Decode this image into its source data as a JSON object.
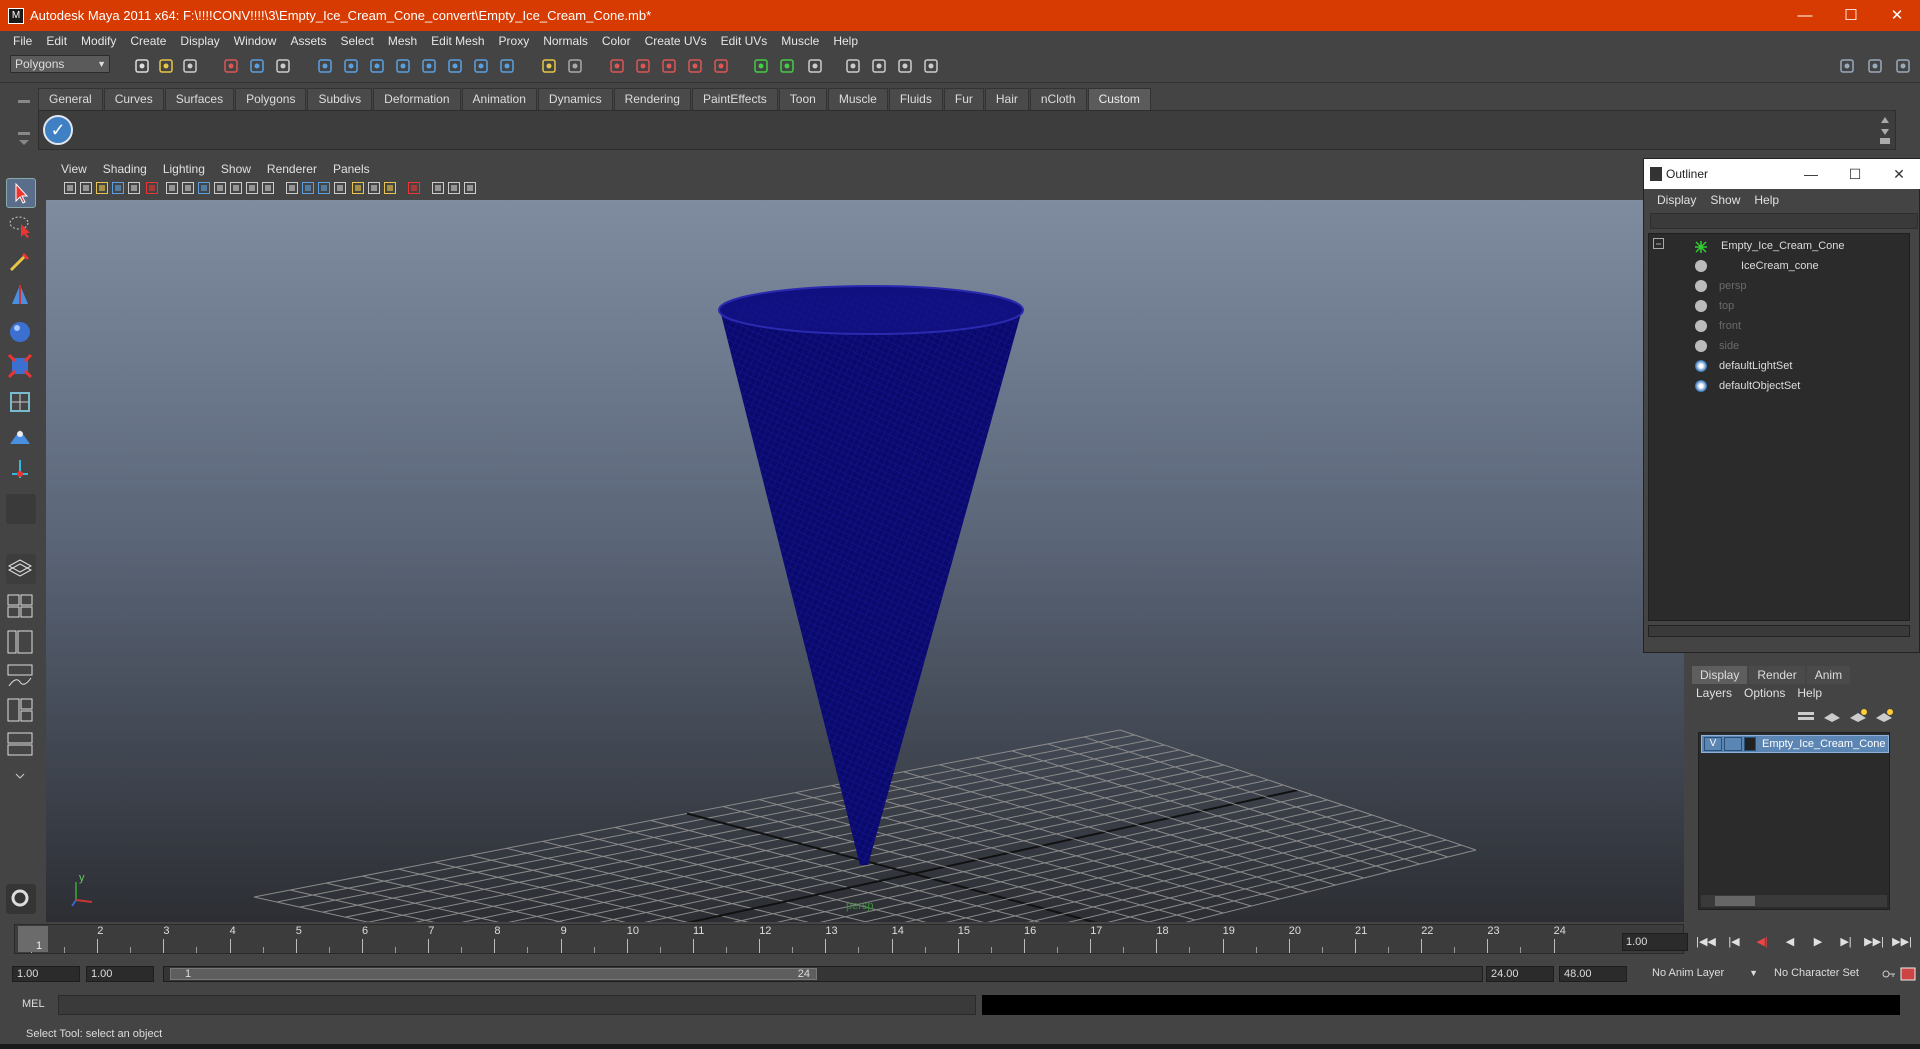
{
  "window": {
    "title": "Autodesk Maya 2011 x64: F:\\!!!!CONV!!!!\\3\\Empty_Ice_Cream_Cone_convert\\Empty_Ice_Cream_Cone.mb*",
    "minimize": "—",
    "maximize": "☐",
    "close": "✕"
  },
  "menubar": [
    "File",
    "Edit",
    "Modify",
    "Create",
    "Display",
    "Window",
    "Assets",
    "Select",
    "Mesh",
    "Edit Mesh",
    "Proxy",
    "Normals",
    "Color",
    "Create UVs",
    "Edit UVs",
    "Muscle",
    "Help"
  ],
  "status_line": {
    "mode": "Polygons"
  },
  "shelf": {
    "tabs": [
      "General",
      "Curves",
      "Surfaces",
      "Polygons",
      "Subdivs",
      "Deformation",
      "Animation",
      "Dynamics",
      "Rendering",
      "PaintEffects",
      "Toon",
      "Muscle",
      "Fluids",
      "Fur",
      "Hair",
      "nCloth",
      "Custom"
    ],
    "active_tab": "Custom",
    "item_icon": "checkmark-icon"
  },
  "viewport": {
    "menu": [
      "View",
      "Shading",
      "Lighting",
      "Show",
      "Renderer",
      "Panels"
    ],
    "camera_label": "persp",
    "mesh_color": "#0a0a6e",
    "axis_y": "y",
    "axis_x": "x"
  },
  "outliner": {
    "title": "Outliner",
    "menu": [
      "Display",
      "Show",
      "Help"
    ],
    "items": [
      {
        "label": "Empty_Ice_Cream_Cone",
        "dim": false
      },
      {
        "label": "IceCream_cone",
        "dim": false
      },
      {
        "label": "persp",
        "dim": true
      },
      {
        "label": "top",
        "dim": true
      },
      {
        "label": "front",
        "dim": true
      },
      {
        "label": "side",
        "dim": true
      },
      {
        "label": "defaultLightSet",
        "dim": false
      },
      {
        "label": "defaultObjectSet",
        "dim": false
      }
    ]
  },
  "layer_editor": {
    "tabs": [
      "Display",
      "Render",
      "Anim"
    ],
    "active_tab": "Display",
    "menu": [
      "Layers",
      "Options",
      "Help"
    ],
    "layer": {
      "visible": "V",
      "name": "Empty_Ice_Cream_Cone"
    }
  },
  "time_slider": {
    "ticks": [
      "1",
      "2",
      "3",
      "4",
      "5",
      "6",
      "7",
      "8",
      "9",
      "10",
      "11",
      "12",
      "13",
      "14",
      "15",
      "16",
      "17",
      "18",
      "19",
      "20",
      "21",
      "22",
      "23",
      "24"
    ],
    "current_frame": "1",
    "current_time_field": "1.00",
    "playback": [
      "|◀◀",
      "|◀",
      "◀|",
      "◀",
      "▶",
      "▶|",
      "▶▶|",
      "▶▶|"
    ]
  },
  "range_slider": {
    "start_time": "1.00",
    "playback_start": "1.00",
    "range_start": "1",
    "range_end": "24",
    "playback_end": "24.00",
    "end_time": "48.00",
    "anim_layer": "No Anim Layer",
    "character_set": "No Character Set"
  },
  "command_line": {
    "label": "MEL"
  },
  "help_line": {
    "text": "Select Tool: select an object"
  },
  "colors": {
    "title_bar": "#d83b01",
    "ui_bg": "#444444",
    "selection": "#5b85b3"
  }
}
